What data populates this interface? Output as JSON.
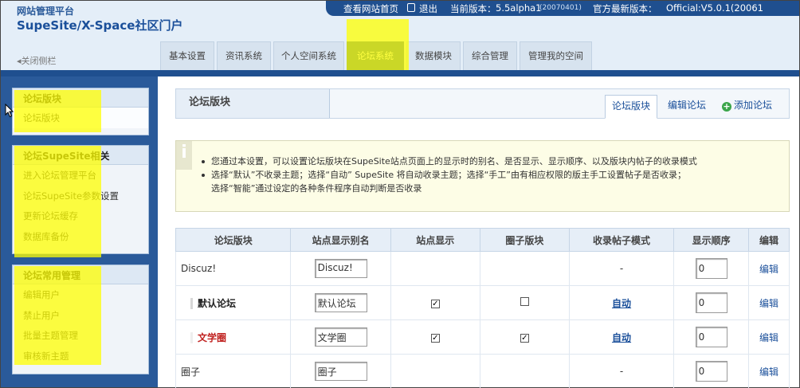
{
  "brand": {
    "small": "网站管理平台",
    "title": "SupeSite/X-Space社区门户"
  },
  "topbar": {
    "home_link": "查看网站首页",
    "logout_icon": "logout-icon",
    "logout": "退出",
    "current_version_label": "当前版本：",
    "current_version": "5.5alpha1",
    "current_build": "(20070401)",
    "latest_version_label": "官方最新版本：",
    "latest_version": "Official:V5.0.1(20061"
  },
  "close_sidebar": "◂关闭侧栏",
  "tabs": [
    {
      "label": "基本设置"
    },
    {
      "label": "资讯系统"
    },
    {
      "label": "个人空间系统"
    },
    {
      "label": "论坛系统"
    },
    {
      "label": "数据模块"
    },
    {
      "label": "综合管理"
    },
    {
      "label": "管理我的空间"
    }
  ],
  "sidebar": {
    "panels": [
      {
        "title": "论坛版块",
        "items": [
          "论坛版块"
        ]
      },
      {
        "title": "论坛SupeSite相关",
        "items": [
          "进入论坛管理平台",
          "论坛SupeSite参数设置",
          "更新论坛缓存",
          "数据库备份"
        ]
      },
      {
        "title": "论坛常用管理",
        "items": [
          "编辑用户",
          "禁止用户",
          "批量主题管理",
          "审核新主题"
        ]
      }
    ]
  },
  "main": {
    "title": "论坛版块",
    "subtabs": [
      "论坛版块",
      "编辑论坛",
      "添加论坛"
    ],
    "notice": [
      "您通过本设置，可以设置论坛版块在SupeSite站点页面上的显示时的别名、是否显示、显示顺序、以及版块内帖子的收录模式",
      "选择“默认”不收录主题；选择“自动” SupeSite 将自动收录主题；选择“手工”由有相应权限的版主手工设置帖子是否收录；",
      "选择“智能”通过设定的各种条件程序自动判断是否收录"
    ],
    "table": {
      "headers": [
        "论坛版块",
        "站点显示别名",
        "站点显示",
        "圈子版块",
        "收录帖子模式",
        "显示顺序",
        "编辑"
      ],
      "rows": [
        {
          "name": "Discuz!",
          "alias": "Discuz!",
          "site_show": "",
          "group": "",
          "mode": "-",
          "order": "0",
          "edit": "编辑"
        },
        {
          "name": "默认论坛",
          "alias": "默认论坛",
          "site_show": "✓",
          "group": "",
          "mode": "自动",
          "order": "0",
          "edit": "编辑"
        },
        {
          "name": "文学圈",
          "alias": "文学圈",
          "site_show": "✓",
          "group": "✓",
          "mode": "自动",
          "order": "0",
          "edit": "编辑"
        },
        {
          "name": "圈子",
          "alias": "圈子",
          "site_show": "",
          "group": "",
          "mode": "-",
          "order": "0",
          "edit": "编辑"
        }
      ]
    }
  },
  "colors": {
    "primary": "#1f4f8f",
    "highlight": "#ffff00",
    "forum_red": "#c0211f"
  }
}
